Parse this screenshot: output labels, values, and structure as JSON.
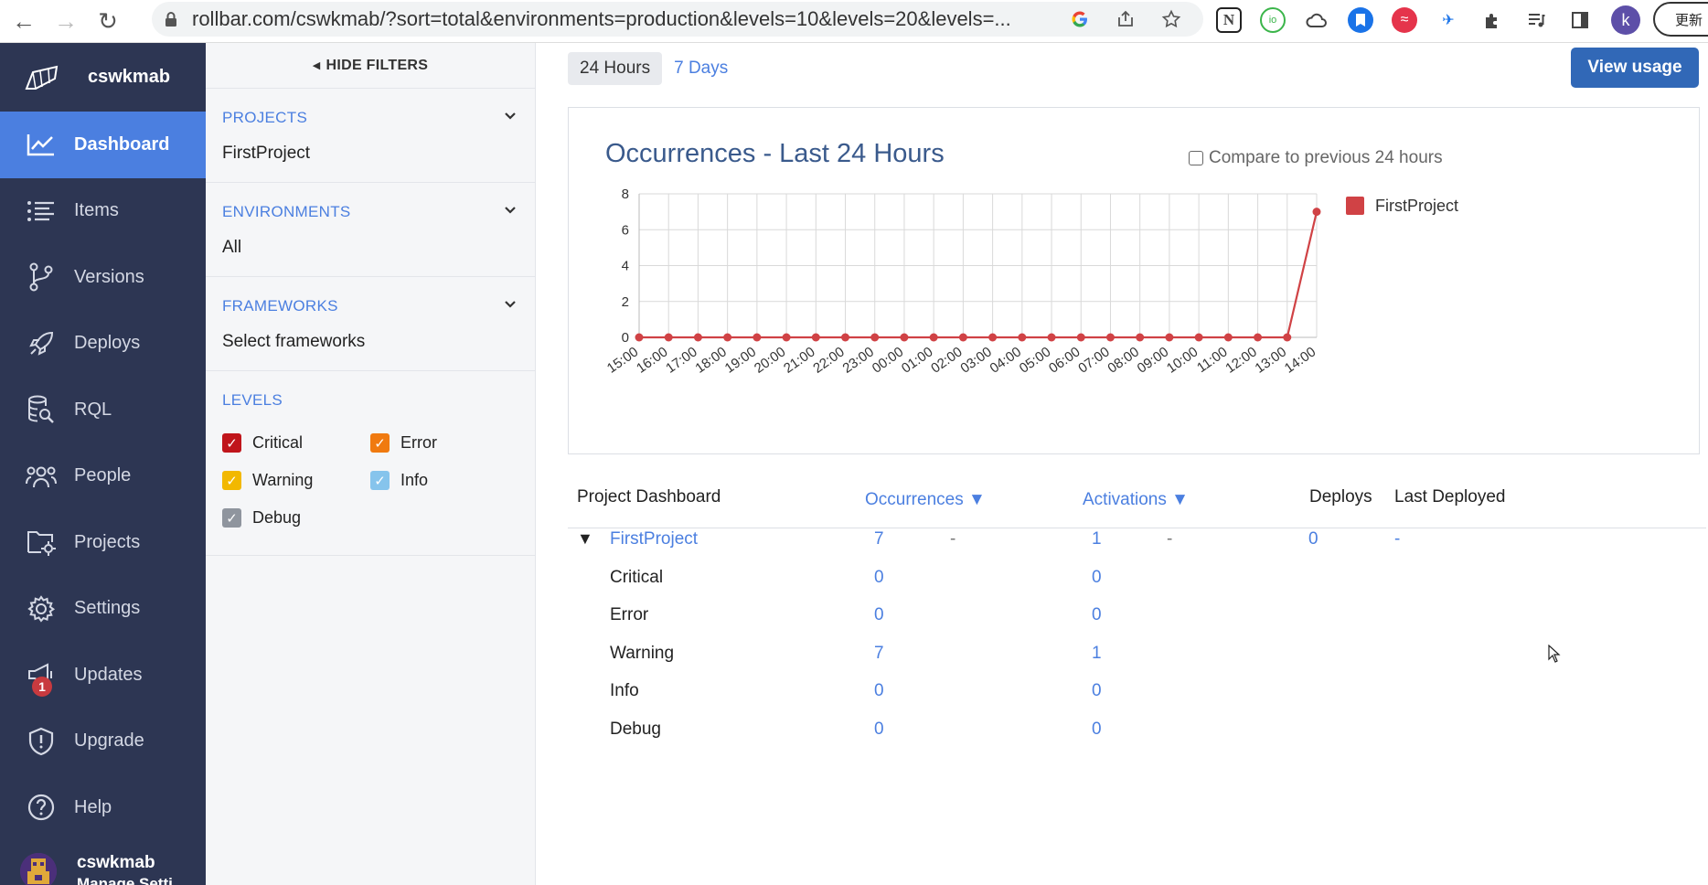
{
  "browser": {
    "url": "rollbar.com/cswkmab/?sort=total&environments=production&levels=10&levels=20&levels=...",
    "profile_initial": "k",
    "update_label": "更新"
  },
  "sidebar": {
    "account_name": "cswkmab",
    "items": [
      {
        "label": "Dashboard",
        "icon": "chart-line-icon"
      },
      {
        "label": "Items",
        "icon": "list-icon"
      },
      {
        "label": "Versions",
        "icon": "git-branch-icon"
      },
      {
        "label": "Deploys",
        "icon": "rocket-icon"
      },
      {
        "label": "RQL",
        "icon": "database-search-icon"
      },
      {
        "label": "People",
        "icon": "people-icon"
      },
      {
        "label": "Projects",
        "icon": "folder-gear-icon"
      },
      {
        "label": "Settings",
        "icon": "gear-icon"
      },
      {
        "label": "Updates",
        "icon": "megaphone-icon",
        "badge": "1"
      },
      {
        "label": "Upgrade",
        "icon": "shield-icon"
      },
      {
        "label": "Help",
        "icon": "help-circle-icon"
      }
    ],
    "footer": {
      "name": "cswkmab",
      "sub": "Manage Setti"
    }
  },
  "filters": {
    "hide_label": "HIDE FILTERS",
    "projects": {
      "heading": "PROJECTS",
      "value": "FirstProject"
    },
    "environments": {
      "heading": "ENVIRONMENTS",
      "value": "All"
    },
    "frameworks": {
      "heading": "FRAMEWORKS",
      "value": "Select frameworks"
    },
    "levels": {
      "heading": "LEVELS",
      "items": [
        {
          "label": "Critical",
          "color": "#c0151b",
          "checked": true
        },
        {
          "label": "Error",
          "color": "#f07a10",
          "checked": true
        },
        {
          "label": "Warning",
          "color": "#f2b800",
          "checked": true
        },
        {
          "label": "Info",
          "color": "#86c4ec",
          "checked": true
        },
        {
          "label": "Debug",
          "color": "#8f959e",
          "checked": true
        }
      ]
    }
  },
  "main": {
    "tabs": [
      "24 Hours",
      "7 Days"
    ],
    "view_usage": "View usage",
    "chart_title": "Occurrences - Last 24 Hours",
    "compare_label": "Compare to previous 24 hours"
  },
  "chart_data": {
    "type": "line",
    "title": "Occurrences - Last 24 Hours",
    "xlabel": "",
    "ylabel": "",
    "ylim": [
      0,
      8
    ],
    "yticks": [
      0,
      2,
      4,
      6,
      8
    ],
    "categories": [
      "15:00",
      "16:00",
      "17:00",
      "18:00",
      "19:00",
      "20:00",
      "21:00",
      "22:00",
      "23:00",
      "00:00",
      "01:00",
      "02:00",
      "03:00",
      "04:00",
      "05:00",
      "06:00",
      "07:00",
      "08:00",
      "09:00",
      "10:00",
      "11:00",
      "12:00",
      "13:00",
      "14:00"
    ],
    "series": [
      {
        "name": "FirstProject",
        "color": "#d04245",
        "values": [
          0,
          0,
          0,
          0,
          0,
          0,
          0,
          0,
          0,
          0,
          0,
          0,
          0,
          0,
          0,
          0,
          0,
          0,
          0,
          0,
          0,
          0,
          0,
          7
        ]
      }
    ],
    "grid": true,
    "legend": "right"
  },
  "table": {
    "headers": {
      "project": "Project Dashboard",
      "occurrences": "Occurrences ▼",
      "activations": "Activations ▼",
      "deploys": "Deploys",
      "last_deployed": "Last Deployed"
    },
    "project": {
      "expander": "▼",
      "name": "FirstProject",
      "occurrences": "7",
      "occ_change": "-",
      "activations": "1",
      "act_change": "-",
      "deploys": "0",
      "last_deployed": "-"
    },
    "rows": [
      {
        "level": "Critical",
        "occurrences": "0",
        "activations": "0"
      },
      {
        "level": "Error",
        "occurrences": "0",
        "activations": "0"
      },
      {
        "level": "Warning",
        "occurrences": "7",
        "activations": "1"
      },
      {
        "level": "Info",
        "occurrences": "0",
        "activations": "0"
      },
      {
        "level": "Debug",
        "occurrences": "0",
        "activations": "0"
      }
    ]
  }
}
